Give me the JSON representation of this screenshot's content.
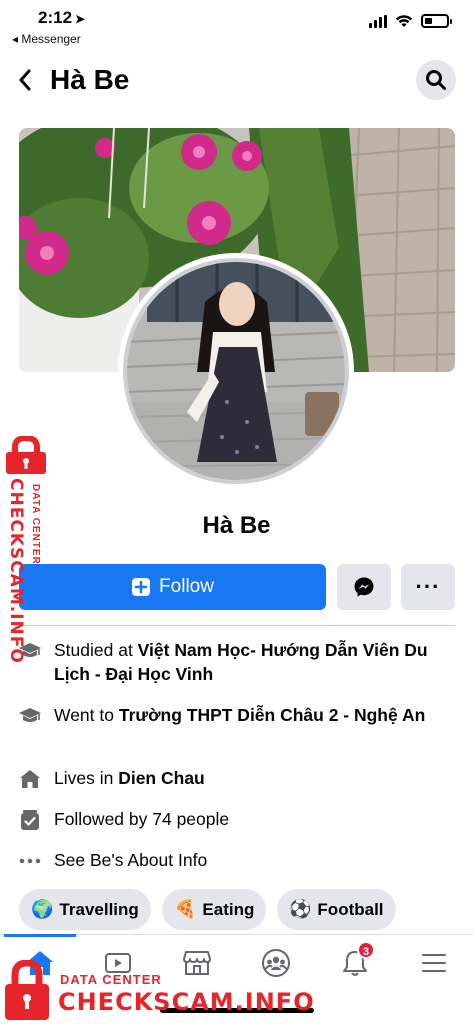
{
  "status_bar": {
    "time": "2:12",
    "back_app": "◂ Messenger"
  },
  "header": {
    "title": "Hà Be",
    "back_icon": "chevron-left-icon",
    "search_icon": "search-icon"
  },
  "profile": {
    "name": "Hà Be"
  },
  "actions": {
    "follow_label": "Follow",
    "primary_color": "#1877f2"
  },
  "info": [
    {
      "prefix": "Studied at ",
      "value": "Việt Nam Học- Hướng Dẫn Viên Du Lịch - Đại Học Vinh",
      "icon": "graduation-cap-icon"
    },
    {
      "prefix": "Went to ",
      "value": "Trường THPT Diễn Châu 2 - Nghệ An",
      "icon": "graduation-cap-icon"
    },
    {
      "prefix": "Lives in ",
      "value": "Dien Chau",
      "icon": "home-icon"
    },
    {
      "prefix": "Followed by 74 people",
      "value": "",
      "icon": "followers-icon"
    },
    {
      "prefix": "See Be's About Info",
      "value": "",
      "icon": "more-horizontal-icon"
    }
  ],
  "interests": [
    {
      "emoji": "🌍",
      "label": "Travelling"
    },
    {
      "emoji": "🍕",
      "label": "Eating"
    },
    {
      "emoji": "⚽",
      "label": "Football"
    }
  ],
  "nav": {
    "notifications_badge": "3"
  },
  "watermark": {
    "vertical_small": "DATA CENTER",
    "vertical_big": "CHECKSCAM.INFO",
    "bottom_small": "DATA CENTER",
    "bottom_big": "CHECKSCAM.INFO"
  }
}
